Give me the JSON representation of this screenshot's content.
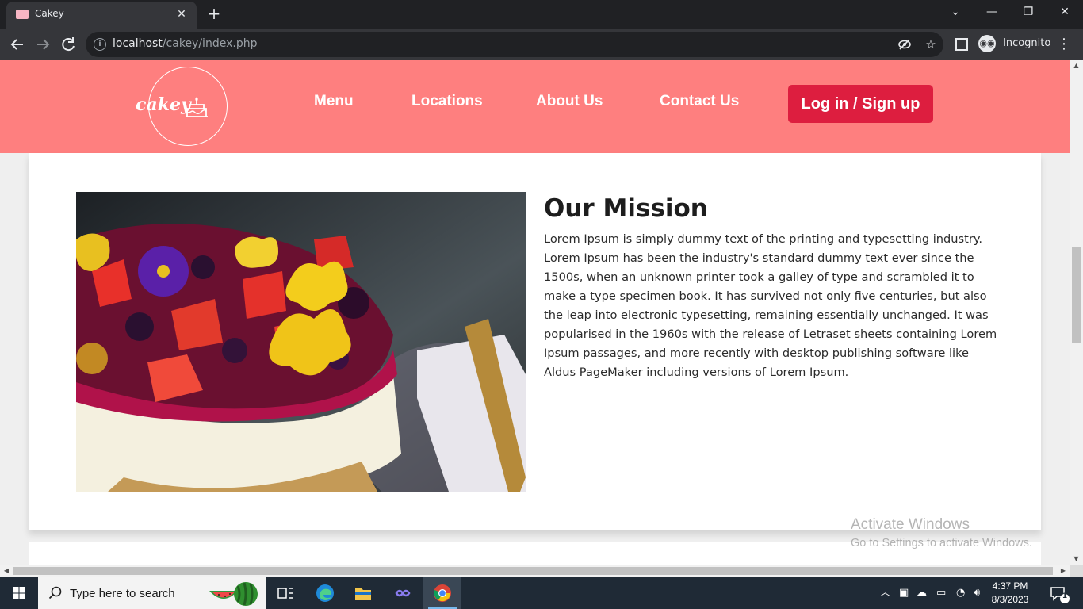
{
  "browser": {
    "tab_title": "Cakey",
    "tab_close": "✕",
    "new_tab": "+",
    "url_host": "localhost",
    "url_path": "/cakey/index.php",
    "incognito_label": "Incognito",
    "window_controls": {
      "dropdown": "⌄",
      "minimize": "—",
      "restore": "❐",
      "close": "✕"
    }
  },
  "site": {
    "logo_text": "cakey",
    "nav": [
      {
        "label": "Menu"
      },
      {
        "label": "Locations"
      },
      {
        "label": "About Us"
      },
      {
        "label": "Contact Us"
      }
    ],
    "login_button": "Log in / Sign up",
    "colors": {
      "header": "#fe7f7f",
      "login": "#dd1e3f"
    }
  },
  "mission": {
    "title": "Our Mission",
    "body": "Lorem Ipsum is simply dummy text of the printing and typesetting industry. Lorem Ipsum has been the industry's standard dummy text ever since the 1500s, when an unknown printer took a galley of type and scrambled it to make a type specimen book. It has survived not only five centuries, but also the leap into electronic typesetting, remaining essentially unchanged. It was popularised in the 1960s with the release of Letraset sheets containing Lorem Ipsum passages, and more recently with desktop publishing software like Aldus PageMaker including versions of Lorem Ipsum."
  },
  "watermark": {
    "line1": "Activate Windows",
    "line2": "Go to Settings to activate Windows."
  },
  "taskbar": {
    "search_placeholder": "Type here to search",
    "time": "4:37 PM",
    "date": "8/3/2023",
    "notification_count": "1"
  }
}
